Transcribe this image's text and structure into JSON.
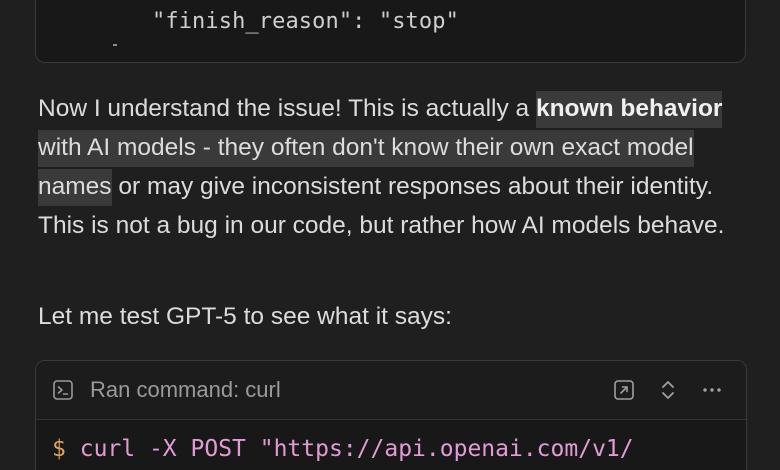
{
  "code_block_top": {
    "line": "\"finish_reason\": \"stop\""
  },
  "message": {
    "p1_a": "Now I understand the issue! This is actually a ",
    "p1_bold": "known behavior",
    "p1_hl": " with AI models - they often don't know their own exact model names",
    "p1_b": " or may give inconsistent responses about their identity. This is not a bug in our code, but rather how AI models behave.",
    "p2": "Let me test GPT-5 to see what it says:"
  },
  "command_card": {
    "title": "Ran command: curl",
    "icon": "terminal-icon",
    "actions": [
      "open-external-icon",
      "expand-collapse-icon",
      "more-icon"
    ],
    "prompt": "$",
    "command": "curl -X POST \"https://api.openai.com/v1/"
  }
}
